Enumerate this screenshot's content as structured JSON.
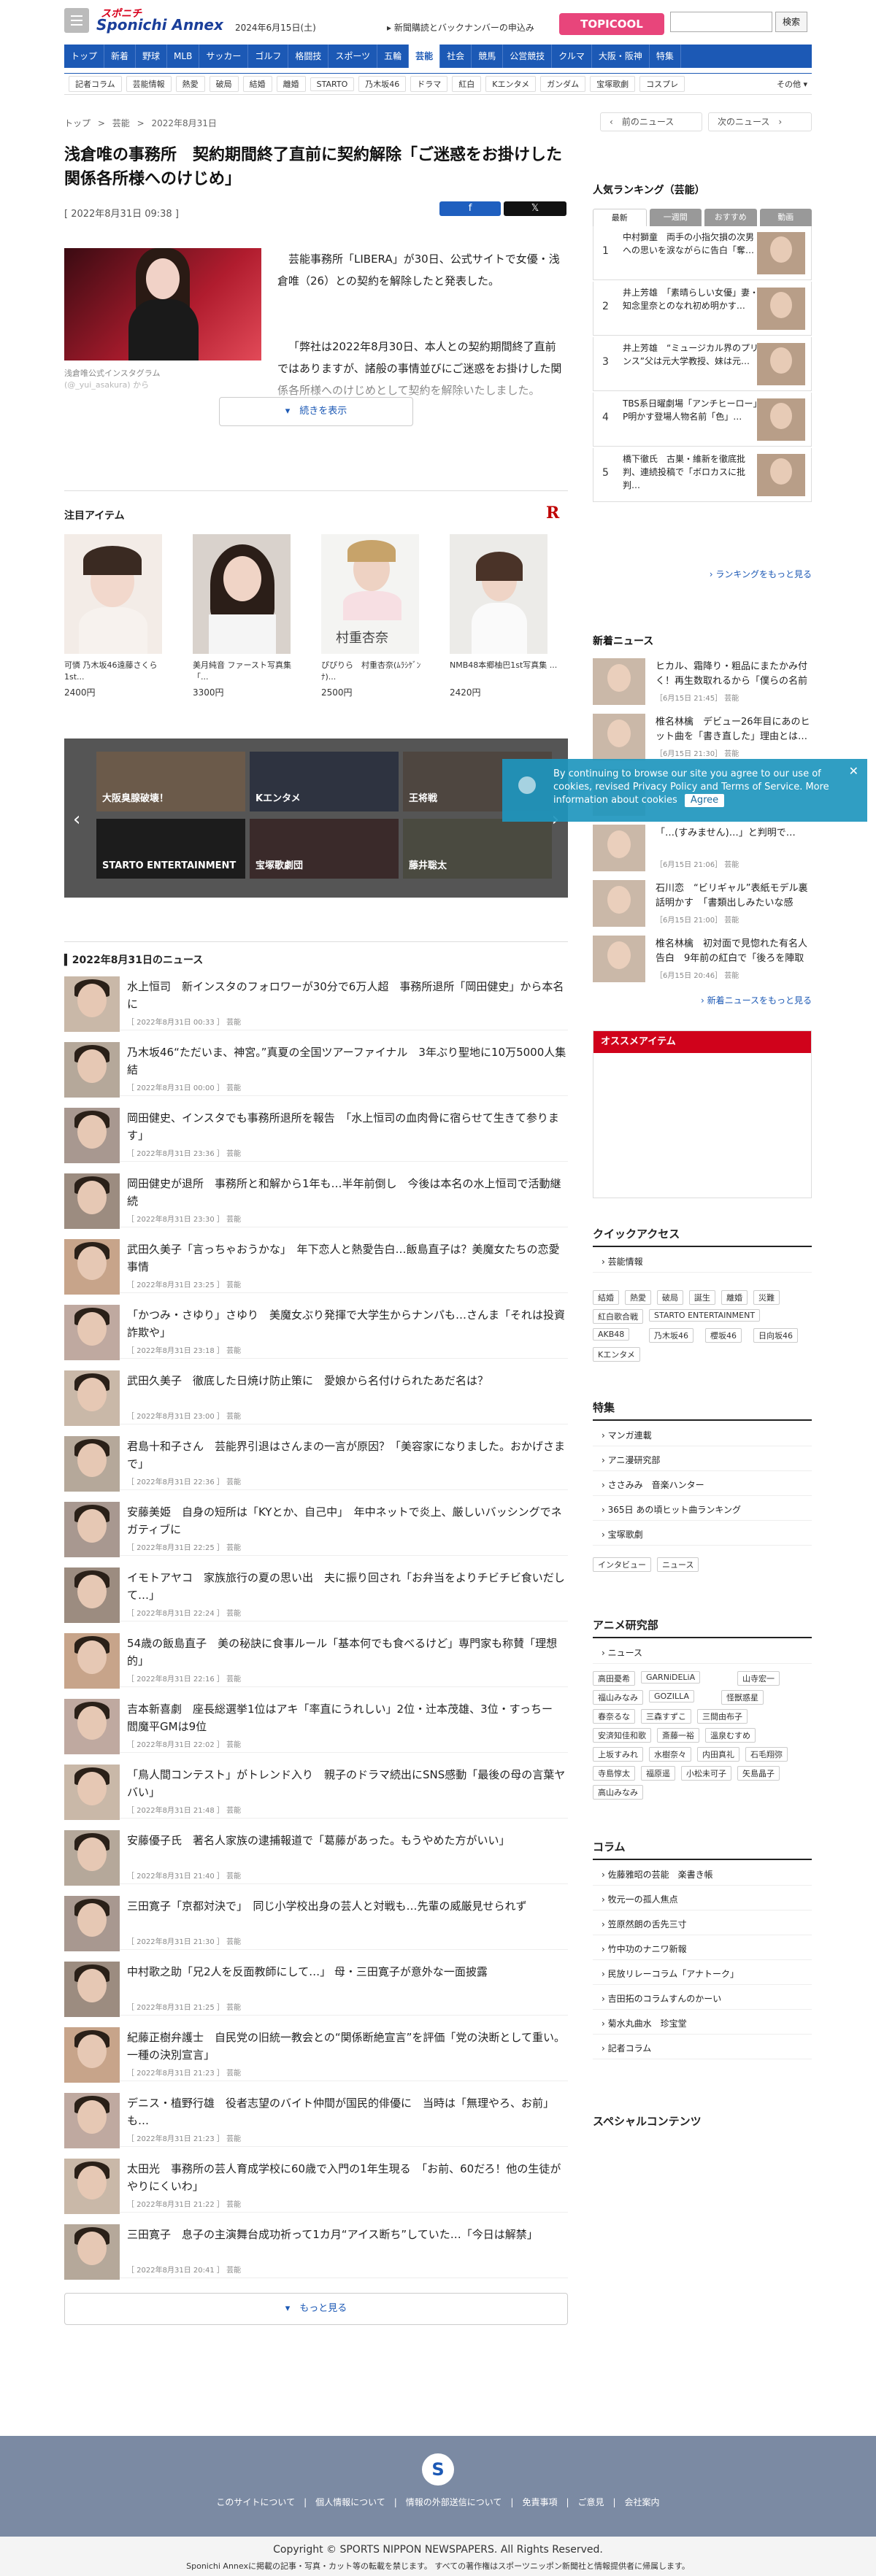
{
  "header": {
    "logo_top": "スポニチ",
    "logo_main": "Sponichi Annex",
    "date": "2024年6月15日(土)",
    "promo": "新聞購読とバックナンバーの申込み",
    "topics": "TOPICOOL",
    "search_button": "検索",
    "search_placeholder": ""
  },
  "nav": [
    "トップ",
    "新着",
    "野球",
    "MLB",
    "サッカー",
    "ゴルフ",
    "格闘技",
    "スポーツ",
    "五輪",
    "芸能",
    "社会",
    "競馬",
    "公営競技",
    "クルマ",
    "大阪・阪神",
    "特集"
  ],
  "nav_active": "芸能",
  "subnav": [
    "記者コラム",
    "芸能情報",
    "熱愛",
    "破局",
    "結婚",
    "離婚",
    "STARTO",
    "乃木坂46",
    "ドラマ",
    "紅白",
    "Kエンタメ",
    "ガンダム",
    "宝塚歌劇",
    "コスプレ"
  ],
  "subnav_more": "その他",
  "breadcrumb": [
    "トップ",
    ">",
    "芸能",
    ">",
    "2022年8月31日"
  ],
  "prev": "前のニュース",
  "next": "次のニュース",
  "article": {
    "title": "浅倉唯の事務所　契約期間終了直前に契約解除「ご迷惑をお掛けした関係各所様へのけじめ」",
    "date": "[ 2022年8月31日 09:38 ]",
    "photo_caption": "浅倉唯公式インスタグラム (@_yui_asakura) から",
    "lead1": "芸能事務所「LIBERA」が30日、公式サイトで女優・浅倉唯（26）との契約を解除したと発表した。",
    "lead2": "「弊社は2022年8月30日、本人との契約期間終了直前ではありますが、諸般の事情並びにご迷惑をお掛けした関係各所様へのけじめとして契約を解除いたしました。",
    "read_more": "続きを表示"
  },
  "featured": {
    "heading": "注目アイテム",
    "brand": "R",
    "products": [
      {
        "title": "可憐 乃木坂46遠藤さくら1st...",
        "price": "2400円"
      },
      {
        "title": "美月純音 ファースト写真集「...",
        "price": "3300円"
      },
      {
        "title": "ぴぴりら　村重杏奈(ﾑﾗｼｹﾞﾝﾅ)...",
        "price": "2500円"
      },
      {
        "title": "NMB48本郷柚巴1st写真集 ...",
        "price": "2420円"
      }
    ],
    "product2_text": "村重杏奈"
  },
  "carousel": [
    "大阪臭腺破壊！",
    "Kエンタメ",
    "王将戦",
    "STARTO ENTERTAINMENT",
    "宝塚歌劇団",
    "藤井聡太"
  ],
  "news_heading": "2022年8月31日のニュース",
  "news": [
    {
      "t": "水上恒司　新インスタのフォロワーが30分で6万人超　事務所退所「岡田健史」から本名に",
      "d": "［ 2022年8月31日 00:33 ］ 芸能"
    },
    {
      "t": "乃木坂46“ただいま、神宮。”真夏の全国ツアーファイナル　3年ぶり聖地に10万5000人集結",
      "d": "［ 2022年8月31日 00:00 ］ 芸能"
    },
    {
      "t": "岡田健史、インスタでも事務所退所を報告　「水上恒司の血肉骨に宿らせて生きて参ります」",
      "d": "［ 2022年8月31日 23:36 ］ 芸能"
    },
    {
      "t": "岡田健史が退所　事務所と和解から1年も…半年前倒し　今後は本名の水上恒司で活動継続",
      "d": "［ 2022年8月31日 23:30 ］ 芸能"
    },
    {
      "t": "武田久美子「言っちゃおうかな」　年下恋人と熱愛告白…飯島直子は？美魔女たちの恋愛事情",
      "d": "［ 2022年8月31日 23:25 ］ 芸能"
    },
    {
      "t": "「かつみ・さゆり」さゆり　美魔女ぶり発揮で大学生からナンパも…さんま「それは投資詐欺や」",
      "d": "［ 2022年8月31日 23:18 ］ 芸能"
    },
    {
      "t": "武田久美子　徹底した日焼け防止策に　愛娘から名付けられたあだ名は？",
      "d": "［ 2022年8月31日 23:00 ］ 芸能"
    },
    {
      "t": "君島十和子さん　芸能界引退はさんまの一言が原因？「美容家になりました。おかげさまで」",
      "d": "［ 2022年8月31日 22:36 ］ 芸能"
    },
    {
      "t": "安藤美姫　自身の短所は「KYとか、自己中」　年中ネットで炎上、厳しいバッシングでネガティブに",
      "d": "［ 2022年8月31日 22:25 ］ 芸能"
    },
    {
      "t": "イモトアヤコ　家族旅行の夏の思い出　夫に振り回され「お弁当をよりチビチビ食いだして…」",
      "d": "［ 2022年8月31日 22:24 ］ 芸能"
    },
    {
      "t": "54歳の飯島直子　美の秘訣に食事ルール「基本何でも食べるけど」専門家も称賛「理想的」",
      "d": "［ 2022年8月31日 22:16 ］ 芸能"
    },
    {
      "t": "吉本新喜劇　座長総選挙1位はアキ「率直にうれしい」2位・辻本茂雄、3位・すっちー　閻魔平GMは9位",
      "d": "［ 2022年8月31日 22:02 ］ 芸能"
    },
    {
      "t": "「鳥人間コンテスト」がトレンド入り　親子のドラマ続出にSNS感動「最後の母の言葉ヤバい」",
      "d": "［ 2022年8月31日 21:48 ］ 芸能"
    },
    {
      "t": "安藤優子氏　著名人家族の逮捕報道で「葛藤があった。もうやめた方がいい」",
      "d": "［ 2022年8月31日 21:40 ］ 芸能"
    },
    {
      "t": "三田寛子「京都対決で」　同じ小学校出身の芸人と対戦も…先輩の威厳見せられず",
      "d": "［ 2022年8月31日 21:30 ］ 芸能"
    },
    {
      "t": "中村歌之助「兄2人を反面教師にして…」 母・三田寛子が意外な一面披露",
      "d": "［ 2022年8月31日 21:25 ］ 芸能"
    },
    {
      "t": "紀藤正樹弁護士　自民党の旧統一教会との“関係断絶宣言”を評価「党の決断として重い。一種の決別宣言」",
      "d": "［ 2022年8月31日 21:23 ］ 芸能"
    },
    {
      "t": "デニス・植野行雄　役者志望のバイト仲間が国民的俳優に　当時は「無理やろ、お前」も…",
      "d": "［ 2022年8月31日 21:23 ］ 芸能"
    },
    {
      "t": "太田光　事務所の芸人育成学校に60歳で入門の1年生現る　「お前、60だろ！他の生徒がやりにくいわ」",
      "d": "［ 2022年8月31日 21:22 ］ 芸能"
    },
    {
      "t": "三田寛子　息子の主演舞台成功祈って1カ月“アイス断ち”していた…「今日は解禁」",
      "d": "［ 2022年8月31日 20:41 ］ 芸能"
    }
  ],
  "more_news": "もっと見る",
  "ranking": {
    "heading": "人気ランキング（芸能）",
    "tabs": [
      "最新",
      "一週間",
      "おすすめ",
      "動画"
    ],
    "items": [
      {
        "n": "1",
        "t": "中村獅童　両手の小指欠損の次男への思いを涙ながらに告白「奪…"
      },
      {
        "n": "2",
        "t": "井上芳雄　「素晴らしい女優」妻・知念里奈とのなれ初め明かす…"
      },
      {
        "n": "3",
        "t": "井上芳雄　“ミュージカル界のプリンス”父は元大学教授、妹は元…"
      },
      {
        "n": "4",
        "t": "TBS系日曜劇場「アンチヒーロー」P明かす登場人物名前「色」…"
      },
      {
        "n": "5",
        "t": "橋下徹氏　古巣・維新を徹底批判、連続投稿で「ボロカスに批判…"
      }
    ],
    "more": "ランキングをもっと見る"
  },
  "sidenews": {
    "heading": "新着ニュース",
    "items": [
      {
        "t": "ヒカル、霜降り・粗品にまたかみ付く！再生数取れるから「僕らの名前使う…",
        "d": "［6月15日 21:45］ 芸能"
      },
      {
        "t": "椎名林檎　デビュー26年目にあのヒット曲を「書き直した」理由とは…",
        "d": "［6月15日 21:30］ 芸能"
      },
      {
        "t": "",
        "d": ""
      },
      {
        "t": "「…(すみません)…」と判明で…",
        "d": "［6月15日 21:06］ 芸能"
      },
      {
        "t": "石川恋　“ビリギャル”表紙モデル裏話明かす　「書類出しみたいな感じ。…やり…",
        "d": "［6月15日 21:00］ 芸能"
      },
      {
        "t": "椎名林檎　初対面で見惚れた有名人告白　9年前の紅白で「後ろを陣取ってお…",
        "d": "［6月15日 20:46］ 芸能"
      }
    ],
    "more": "新着ニュースをもっと見る"
  },
  "cookie": {
    "text": "By continuing to browse our site you agree to our use of cookies, revised Privacy Policy and Terms of Service. More information about cookies",
    "agree": "Agree",
    "close": "✕"
  },
  "osusume": "オススメアイテム",
  "quick": {
    "heading": "クイックアクセス",
    "link": "芸能情報",
    "chips": [
      "結婚",
      "熱愛",
      "破局",
      "誕生",
      "離婚",
      "災難",
      "紅白歌合戦",
      "STARTO ENTERTAINMENT",
      "AKB48",
      "乃木坂46",
      "櫻坂46",
      "日向坂46",
      "Kエンタメ"
    ]
  },
  "tokushu": {
    "heading": "特集",
    "links": [
      "マンガ連載",
      "アニ漫研究部",
      "ささみみ　音楽ハンター",
      "365日 あの頃ヒット曲ランキング",
      "宝塚歌劇"
    ],
    "chips": [
      "インタビュー",
      "ニュース"
    ]
  },
  "anime": {
    "heading": "アニメ研究部",
    "link": "ニュース",
    "chips": [
      "高田憂希",
      "GARNiDELiA",
      "山寺宏一",
      "福山みなみ",
      "GOZILLA",
      "怪獣惑星",
      "春奈るな",
      "三森すずこ",
      "三間由布子",
      "安済知佳和歌",
      "斎藤一裕",
      "溫泉むすめ",
      "上坂すみれ",
      "水樹奈々",
      "内田真礼",
      "石毛翔弥",
      "寺島惇太",
      "福原遥",
      "小松未可子",
      "矢島晶子",
      "高山みなみ"
    ]
  },
  "column": {
    "heading": "コラム",
    "links": [
      "佐藤雅昭の芸能　楽書き帳",
      "牧元一の孤人焦点",
      "笠原然朗の舌先三寸",
      "竹中功のナニワ新報",
      "民放リレーコラム「アナトーク」",
      "吉田拓のコラムすんのかーい",
      "菊水丸曲水　珍宝堂",
      "記者コラム"
    ]
  },
  "special": "スペシャルコンテンツ",
  "footer": {
    "logo": "S",
    "links": "このサイトについて　|　個人情報について　|　情報の外部送信について　|　免責事項　|　ご意見　|　会社案内",
    "copyright": "Copyright © SPORTS NIPPON NEWSPAPERS. All Rights Reserved.",
    "notice": "Sponichi Annexに掲載の記事・写真・カット等の転載を禁じます。 すべての著作権はスポーツニッポン新聞社と情報提供者に帰属します。"
  },
  "colors": {
    "nav": "#1c59b5",
    "topics": "#e8457b",
    "osusume": "#d0021b",
    "footer": "#7b8aa3"
  }
}
